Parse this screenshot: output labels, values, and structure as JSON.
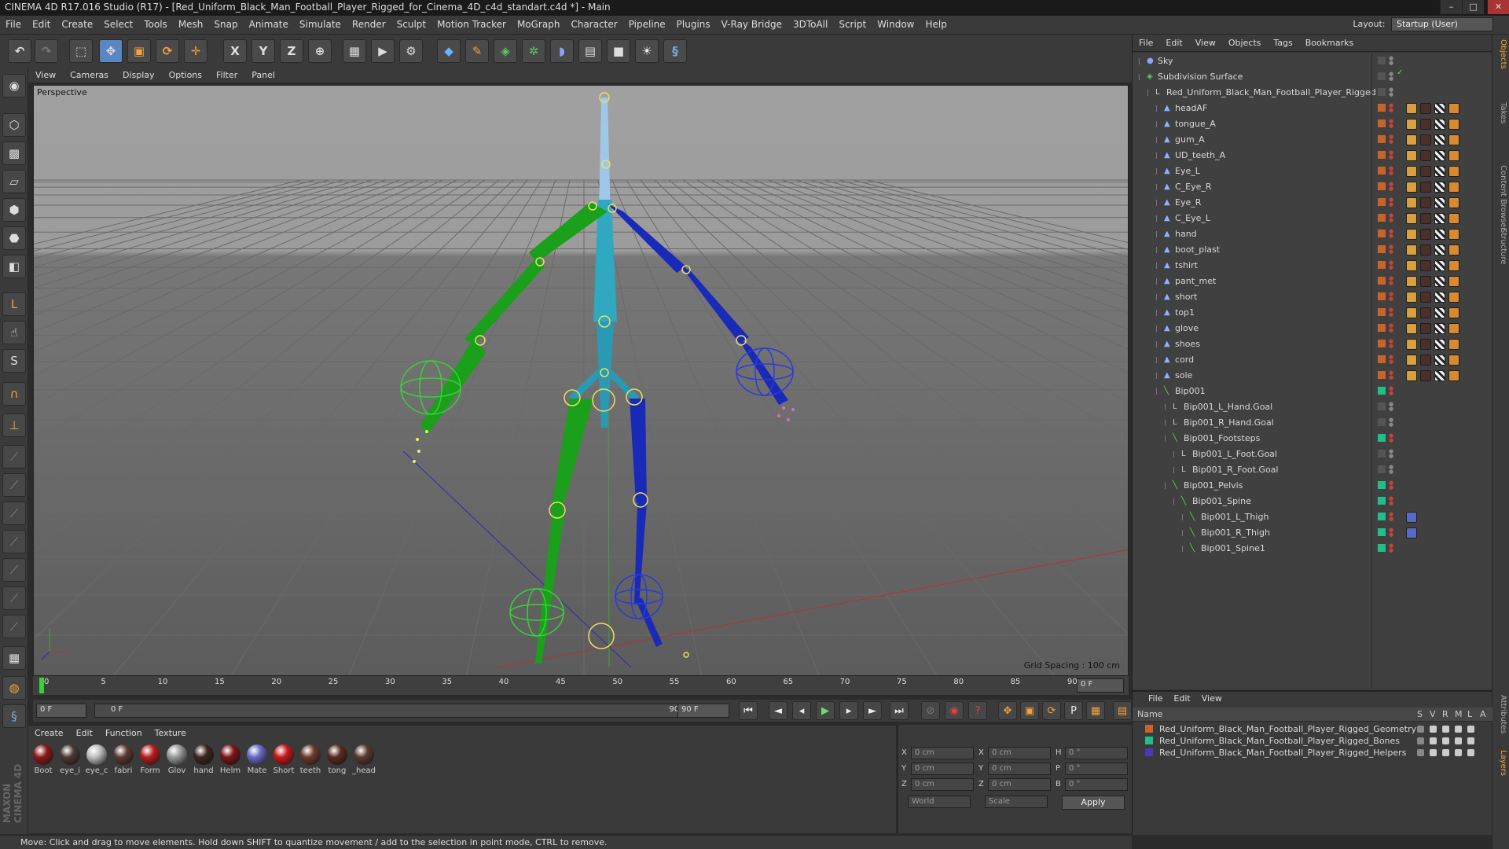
{
  "window": {
    "title": "CINEMA 4D R17.016 Studio (R17) - [Red_Uniform_Black_Man_Football_Player_Rigged_for_Cinema_4D_c4d_standart.c4d *] - Main",
    "layout_label": "Layout:",
    "layout_value": "Startup (User)"
  },
  "menu": [
    "File",
    "Edit",
    "Create",
    "Select",
    "Tools",
    "Mesh",
    "Snap",
    "Animate",
    "Simulate",
    "Render",
    "Sculpt",
    "Motion Tracker",
    "MoGraph",
    "Character",
    "Pipeline",
    "Plugins",
    "V-Ray Bridge",
    "3DToAll",
    "Script",
    "Window",
    "Help"
  ],
  "toolbar": {
    "axis_x": "X",
    "axis_y": "Y",
    "axis_z": "Z"
  },
  "viewport": {
    "menu": [
      "View",
      "Cameras",
      "Display",
      "Options",
      "Filter",
      "Panel"
    ],
    "label": "Perspective",
    "grid_spacing": "Grid Spacing : 100 cm"
  },
  "timeline": {
    "ticks": [
      "0",
      "5",
      "10",
      "15",
      "20",
      "25",
      "30",
      "35",
      "40",
      "45",
      "50",
      "55",
      "60",
      "65",
      "70",
      "75",
      "80",
      "85",
      "90"
    ],
    "frame_end_label": "0 F",
    "current_frame": "0 F",
    "range_start": "0 F",
    "range_end": "90 F",
    "total": "90 F"
  },
  "materials": {
    "menu": [
      "Create",
      "Edit",
      "Function",
      "Texture"
    ],
    "items": [
      {
        "label": "Boot",
        "color": "#8a1a1a"
      },
      {
        "label": "eye_i",
        "color": "#4a3a32"
      },
      {
        "label": "eye_c",
        "color": "#bdbdbd"
      },
      {
        "label": "fabri",
        "color": "#5a3a32"
      },
      {
        "label": "Form",
        "color": "#b81c1c"
      },
      {
        "label": "Glov",
        "color": "#9a9a9a"
      },
      {
        "label": "hand",
        "color": "#3a2620"
      },
      {
        "label": "Helm",
        "color": "#7a1414"
      },
      {
        "label": "Mate",
        "color": "#6a6ac4"
      },
      {
        "label": "Short",
        "color": "#c81818"
      },
      {
        "label": "teeth",
        "color": "#6a3a2a"
      },
      {
        "label": "tong",
        "color": "#5a2a20"
      },
      {
        "label": "_head",
        "color": "#5a3a30"
      }
    ]
  },
  "coords": {
    "x_pos": "0 cm",
    "y_pos": "0 cm",
    "z_pos": "0 cm",
    "x_size": "0 cm",
    "y_size": "0 cm",
    "z_size": "0 cm",
    "h": "0 °",
    "p": "0 °",
    "b": "0 °",
    "labels": {
      "x": "X",
      "y": "Y",
      "z": "Z",
      "h": "H",
      "p": "P",
      "b": "B"
    },
    "mode_world": "World",
    "mode_scale": "Scale",
    "apply": "Apply"
  },
  "status": "Move: Click and drag to move elements. Hold down SHIFT to quantize movement / add to the selection in point mode, CTRL to remove.",
  "objects": {
    "menu": [
      "File",
      "Edit",
      "View",
      "Objects",
      "Tags",
      "Bookmarks"
    ],
    "rows": [
      {
        "name": "Sky",
        "indent": 0,
        "type": "sky"
      },
      {
        "name": "Subdivision Surface",
        "indent": 0,
        "type": "subd"
      },
      {
        "name": "Red_Uniform_Black_Man_Football_Player_Rigged",
        "indent": 1,
        "type": "null"
      },
      {
        "name": "headAF",
        "indent": 2,
        "type": "mesh"
      },
      {
        "name": "tongue_A",
        "indent": 2,
        "type": "mesh"
      },
      {
        "name": "gum_A",
        "indent": 2,
        "type": "mesh"
      },
      {
        "name": "UD_teeth_A",
        "indent": 2,
        "type": "mesh"
      },
      {
        "name": "Eye_L",
        "indent": 2,
        "type": "mesh"
      },
      {
        "name": "C_Eye_R",
        "indent": 2,
        "type": "mesh"
      },
      {
        "name": "Eye_R",
        "indent": 2,
        "type": "mesh"
      },
      {
        "name": "C_Eye_L",
        "indent": 2,
        "type": "mesh"
      },
      {
        "name": "hand",
        "indent": 2,
        "type": "mesh"
      },
      {
        "name": "boot_plast",
        "indent": 2,
        "type": "mesh"
      },
      {
        "name": "tshirt",
        "indent": 2,
        "type": "mesh"
      },
      {
        "name": "pant_met",
        "indent": 2,
        "type": "mesh"
      },
      {
        "name": "short",
        "indent": 2,
        "type": "mesh"
      },
      {
        "name": "top1",
        "indent": 2,
        "type": "mesh"
      },
      {
        "name": "glove",
        "indent": 2,
        "type": "mesh"
      },
      {
        "name": "shoes",
        "indent": 2,
        "type": "mesh"
      },
      {
        "name": "cord",
        "indent": 2,
        "type": "mesh"
      },
      {
        "name": "sole",
        "indent": 2,
        "type": "mesh"
      },
      {
        "name": "Bip001",
        "indent": 2,
        "type": "bone"
      },
      {
        "name": "Bip001_L_Hand.Goal",
        "indent": 3,
        "type": "null"
      },
      {
        "name": "Bip001_R_Hand.Goal",
        "indent": 3,
        "type": "null"
      },
      {
        "name": "Bip001_Footsteps",
        "indent": 3,
        "type": "bone"
      },
      {
        "name": "Bip001_L_Foot.Goal",
        "indent": 4,
        "type": "null"
      },
      {
        "name": "Bip001_R_Foot.Goal",
        "indent": 4,
        "type": "null"
      },
      {
        "name": "Bip001_Pelvis",
        "indent": 3,
        "type": "bone"
      },
      {
        "name": "Bip001_Spine",
        "indent": 4,
        "type": "bone"
      },
      {
        "name": "Bip001_L_Thigh",
        "indent": 5,
        "type": "bone"
      },
      {
        "name": "Bip001_R_Thigh",
        "indent": 5,
        "type": "bone"
      },
      {
        "name": "Bip001_Spine1",
        "indent": 5,
        "type": "bone"
      }
    ]
  },
  "layers": {
    "menu": [
      "File",
      "Edit",
      "View"
    ],
    "header": {
      "name": "Name",
      "s": "S",
      "v": "V",
      "r": "R",
      "m": "M",
      "l": "L",
      "a": "A"
    },
    "rows": [
      {
        "name": "Red_Uniform_Black_Man_Football_Player_Rigged_Geometry",
        "color": "#c8642a"
      },
      {
        "name": "Red_Uniform_Black_Man_Football_Player_Rigged_Bones",
        "color": "#1fbf8a"
      },
      {
        "name": "Red_Uniform_Black_Man_Football_Player_Rigged_Helpers",
        "color": "#4a3ab8"
      }
    ]
  },
  "side_tabs": [
    "Objects",
    "Takes",
    "Content Browser",
    "Structure"
  ],
  "side_tabs_bottom": [
    "Attributes",
    "Layers"
  ]
}
